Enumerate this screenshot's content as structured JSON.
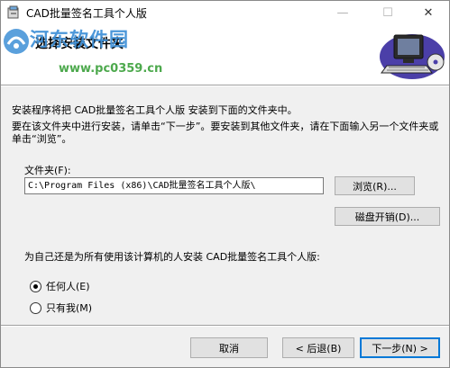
{
  "window": {
    "title": "CAD批量签名工具个人版",
    "controls": {
      "minimize": "—",
      "maximize": "☐",
      "close": "✕"
    }
  },
  "header": {
    "title": "选择安装文件夹",
    "watermark_main": "河东软件园",
    "watermark_url": "www.pc0359.cn"
  },
  "body": {
    "intro": "安装程序将把 CAD批量签名工具个人版 安装到下面的文件夹中。",
    "instructions": "要在该文件夹中进行安装，请单击“下一步”。要安装到其他文件夹，请在下面输入另一个文件夹或单击“浏览”。",
    "folder_label": "文件夹(F):",
    "folder_value": "C:\\Program Files (x86)\\CAD批量签名工具个人版\\",
    "browse_label": "浏览(R)...",
    "disk_cost_label": "磁盘开销(D)...",
    "scope_question": "为自己还是为所有使用该计算机的人安装 CAD批量签名工具个人版:",
    "radio_everyone": "任何人(E)",
    "radio_justme": "只有我(M)",
    "selected_scope": "everyone"
  },
  "footer": {
    "cancel_label": "取消",
    "back_label": "< 后退(B)",
    "next_label": "下一步(N) >"
  }
}
